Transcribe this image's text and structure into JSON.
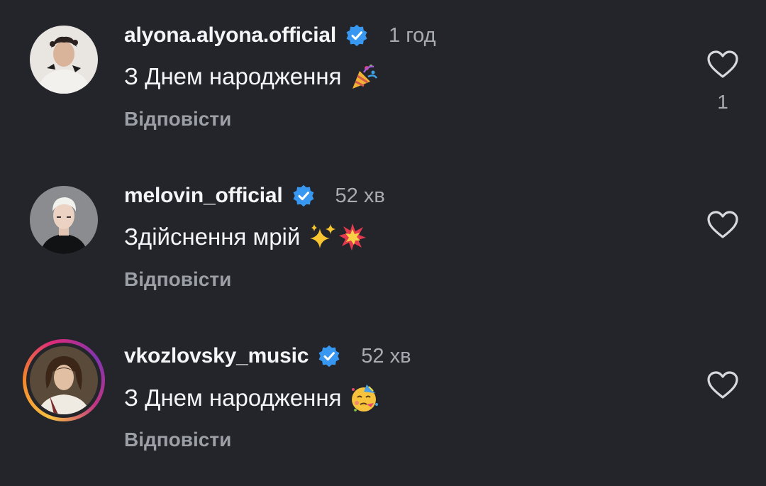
{
  "comments": [
    {
      "username": "alyona.alyona.official",
      "verified": true,
      "time": "1 год",
      "text": "З Днем народження",
      "emoji": "party-popper",
      "reply_label": "Відповісти",
      "like_count": "1",
      "avatar": "alyona-photo",
      "story_ring": false
    },
    {
      "username": "melovin_official",
      "verified": true,
      "time": "52 хв",
      "text": "Здійснення мрій",
      "emoji": "sparkles-collision",
      "reply_label": "Відповісти",
      "like_count": "",
      "avatar": "melovin-photo",
      "story_ring": false
    },
    {
      "username": "vkozlovsky_music",
      "verified": true,
      "time": "52 хв",
      "text": "З Днем народження",
      "emoji": "partying-face",
      "reply_label": "Відповісти",
      "like_count": "",
      "avatar": "vkozlovsky-photo",
      "story_ring": true
    }
  ],
  "colors": {
    "background": "#24252a",
    "verified": "#3897f0",
    "muted": "#a8abb2",
    "reply": "#9c9fa6"
  }
}
